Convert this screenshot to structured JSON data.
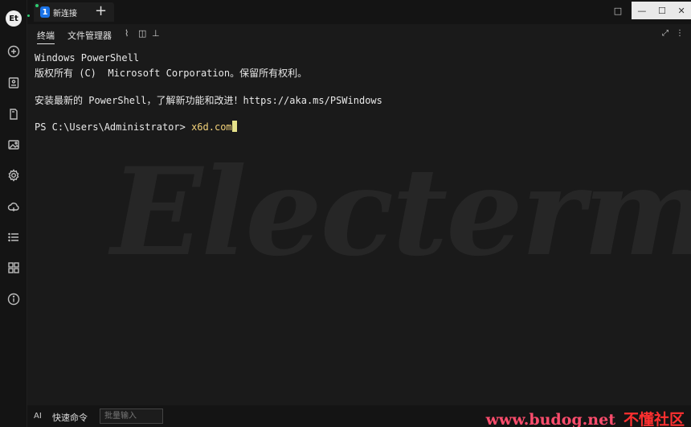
{
  "app": {
    "logo_text": "Et",
    "tabs": [
      {
        "number": "1",
        "title": "新连接"
      }
    ],
    "add_tab_label": "+",
    "window_controls": {
      "layout": "□",
      "minimize": "—",
      "maximize": "☐",
      "close": "✕"
    }
  },
  "sidebar": {
    "icons": [
      "plus-circle-icon",
      "bookmarks-icon",
      "file-icon",
      "image-icon",
      "settings-icon",
      "cloud-sync-icon",
      "list-icon",
      "apps-grid-icon",
      "info-icon"
    ]
  },
  "toolbar": {
    "tabs": [
      "终端",
      "文件管理器"
    ],
    "icons": [
      "paperclip-icon",
      "split-view-icon",
      "sitemap-icon"
    ],
    "right_icons": [
      "fullscreen-icon",
      "menu-dots-icon"
    ]
  },
  "terminal": {
    "lines": [
      "Windows PowerShell",
      "版权所有 (C)  Microsoft Corporation。保留所有权利。",
      "",
      "安装最新的 PowerShell，了解新功能和改进！https://aka.ms/PSWindows",
      ""
    ],
    "prompt": "PS C:\\Users\\Administrator> ",
    "command": "x6d.com",
    "background_watermark": "Electerm"
  },
  "bottom": {
    "ai_label": "AI",
    "quick_commands_label": "快速命令",
    "batch_input_placeholder": "批量输入"
  },
  "overlay_watermark": {
    "site": "www.budog.net",
    "label": "不懂社区"
  },
  "colors": {
    "accent": "#1a73e8",
    "status_dot": "#2ecc71",
    "command": "#f3d27a",
    "cursor": "#e6e28a"
  }
}
